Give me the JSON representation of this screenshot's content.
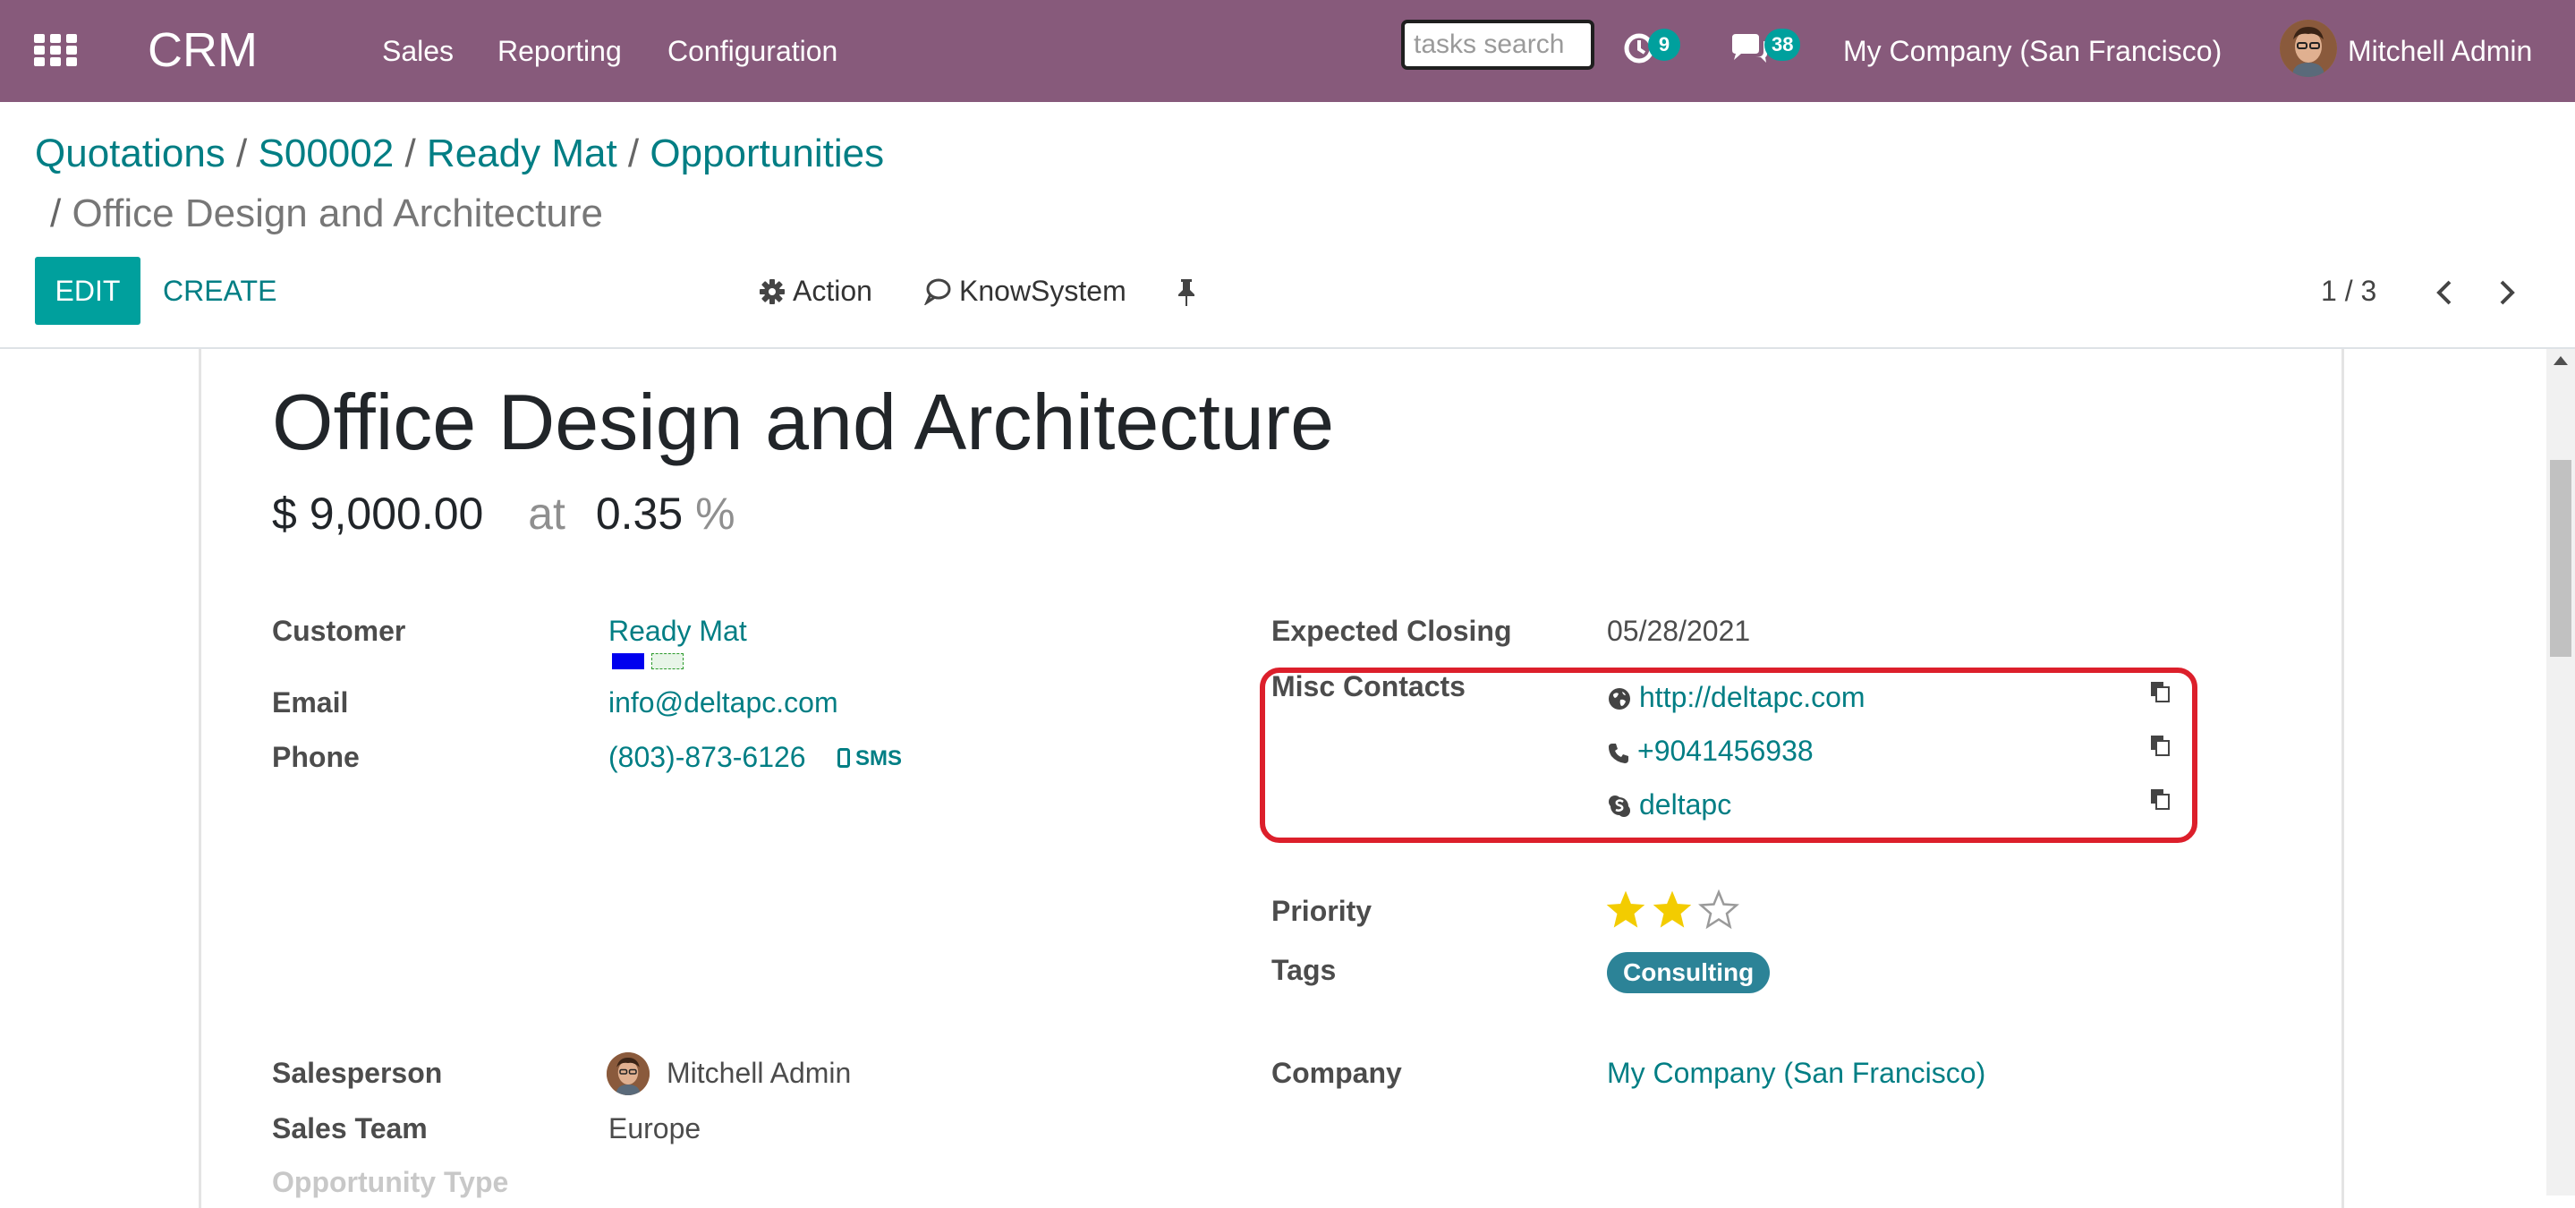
{
  "navbar": {
    "app_name": "CRM",
    "menus": [
      "Sales",
      "Reporting",
      "Configuration"
    ],
    "search_placeholder": "tasks search",
    "activity_count": "9",
    "message_count": "38",
    "company": "My Company (San Francisco)",
    "user": "Mitchell Admin",
    "icons": [
      "apps-grid-icon",
      "clock-icon",
      "chat-icon"
    ]
  },
  "breadcrumb": {
    "items": [
      "Quotations",
      "S00002",
      "Ready Mat",
      "Opportunities"
    ],
    "separator": "/",
    "current": "Office Design and Architecture"
  },
  "toolbar": {
    "edit_label": "EDIT",
    "create_label": "CREATE",
    "action_label": "Action",
    "knowsystem_label": "KnowSystem",
    "pager": "1 / 3"
  },
  "record": {
    "title": "Office Design and Architecture",
    "revenue": "$ 9,000.00",
    "at_label": "at",
    "probability": "0.35",
    "percent_sign": "%",
    "fields_left": {
      "customer_label": "Customer",
      "customer_value": "Ready Mat",
      "email_label": "Email",
      "email_value": "info@deltapc.com",
      "phone_label": "Phone",
      "phone_value": "(803)-873-6126",
      "sms_label": "SMS"
    },
    "fields_right": {
      "expected_closing_label": "Expected Closing",
      "expected_closing_value": "05/28/2021",
      "misc_contacts_label": "Misc Contacts",
      "misc_contacts": [
        {
          "icon": "globe-icon",
          "value": "http://deltapc.com"
        },
        {
          "icon": "phone-icon",
          "value": "+9041456938"
        },
        {
          "icon": "skype-icon",
          "value": "deltapc"
        }
      ],
      "priority_label": "Priority",
      "priority_stars": 2,
      "priority_max": 3,
      "tags_label": "Tags",
      "tags": [
        "Consulting"
      ]
    },
    "fields_bottom": {
      "salesperson_label": "Salesperson",
      "salesperson_value": "Mitchell Admin",
      "sales_team_label": "Sales Team",
      "sales_team_value": "Europe",
      "opportunity_type_label": "Opportunity Type",
      "company_label": "Company",
      "company_value": "My Company (San Francisco)"
    }
  },
  "colors": {
    "navbar": "#875a7b",
    "accent": "#00a09d",
    "link": "#017e84",
    "highlight": "#dc1f2b",
    "tag": "#2c8397",
    "star": "#f3cc00"
  }
}
